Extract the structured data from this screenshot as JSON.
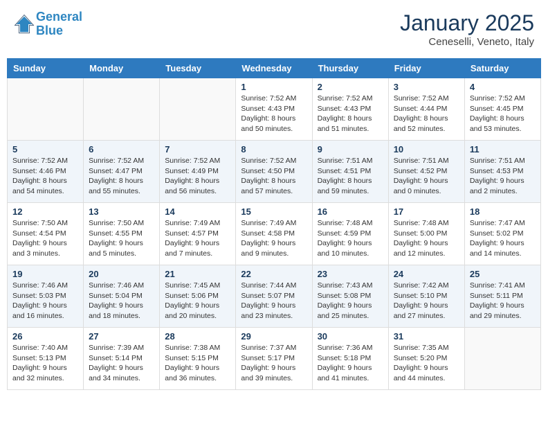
{
  "header": {
    "logo_line1": "General",
    "logo_line2": "Blue",
    "month": "January 2025",
    "location": "Ceneselli, Veneto, Italy"
  },
  "weekdays": [
    "Sunday",
    "Monday",
    "Tuesday",
    "Wednesday",
    "Thursday",
    "Friday",
    "Saturday"
  ],
  "weeks": [
    [
      {
        "day": "",
        "info": ""
      },
      {
        "day": "",
        "info": ""
      },
      {
        "day": "",
        "info": ""
      },
      {
        "day": "1",
        "info": "Sunrise: 7:52 AM\nSunset: 4:43 PM\nDaylight: 8 hours\nand 50 minutes."
      },
      {
        "day": "2",
        "info": "Sunrise: 7:52 AM\nSunset: 4:43 PM\nDaylight: 8 hours\nand 51 minutes."
      },
      {
        "day": "3",
        "info": "Sunrise: 7:52 AM\nSunset: 4:44 PM\nDaylight: 8 hours\nand 52 minutes."
      },
      {
        "day": "4",
        "info": "Sunrise: 7:52 AM\nSunset: 4:45 PM\nDaylight: 8 hours\nand 53 minutes."
      }
    ],
    [
      {
        "day": "5",
        "info": "Sunrise: 7:52 AM\nSunset: 4:46 PM\nDaylight: 8 hours\nand 54 minutes."
      },
      {
        "day": "6",
        "info": "Sunrise: 7:52 AM\nSunset: 4:47 PM\nDaylight: 8 hours\nand 55 minutes."
      },
      {
        "day": "7",
        "info": "Sunrise: 7:52 AM\nSunset: 4:49 PM\nDaylight: 8 hours\nand 56 minutes."
      },
      {
        "day": "8",
        "info": "Sunrise: 7:52 AM\nSunset: 4:50 PM\nDaylight: 8 hours\nand 57 minutes."
      },
      {
        "day": "9",
        "info": "Sunrise: 7:51 AM\nSunset: 4:51 PM\nDaylight: 8 hours\nand 59 minutes."
      },
      {
        "day": "10",
        "info": "Sunrise: 7:51 AM\nSunset: 4:52 PM\nDaylight: 9 hours\nand 0 minutes."
      },
      {
        "day": "11",
        "info": "Sunrise: 7:51 AM\nSunset: 4:53 PM\nDaylight: 9 hours\nand 2 minutes."
      }
    ],
    [
      {
        "day": "12",
        "info": "Sunrise: 7:50 AM\nSunset: 4:54 PM\nDaylight: 9 hours\nand 3 minutes."
      },
      {
        "day": "13",
        "info": "Sunrise: 7:50 AM\nSunset: 4:55 PM\nDaylight: 9 hours\nand 5 minutes."
      },
      {
        "day": "14",
        "info": "Sunrise: 7:49 AM\nSunset: 4:57 PM\nDaylight: 9 hours\nand 7 minutes."
      },
      {
        "day": "15",
        "info": "Sunrise: 7:49 AM\nSunset: 4:58 PM\nDaylight: 9 hours\nand 9 minutes."
      },
      {
        "day": "16",
        "info": "Sunrise: 7:48 AM\nSunset: 4:59 PM\nDaylight: 9 hours\nand 10 minutes."
      },
      {
        "day": "17",
        "info": "Sunrise: 7:48 AM\nSunset: 5:00 PM\nDaylight: 9 hours\nand 12 minutes."
      },
      {
        "day": "18",
        "info": "Sunrise: 7:47 AM\nSunset: 5:02 PM\nDaylight: 9 hours\nand 14 minutes."
      }
    ],
    [
      {
        "day": "19",
        "info": "Sunrise: 7:46 AM\nSunset: 5:03 PM\nDaylight: 9 hours\nand 16 minutes."
      },
      {
        "day": "20",
        "info": "Sunrise: 7:46 AM\nSunset: 5:04 PM\nDaylight: 9 hours\nand 18 minutes."
      },
      {
        "day": "21",
        "info": "Sunrise: 7:45 AM\nSunset: 5:06 PM\nDaylight: 9 hours\nand 20 minutes."
      },
      {
        "day": "22",
        "info": "Sunrise: 7:44 AM\nSunset: 5:07 PM\nDaylight: 9 hours\nand 23 minutes."
      },
      {
        "day": "23",
        "info": "Sunrise: 7:43 AM\nSunset: 5:08 PM\nDaylight: 9 hours\nand 25 minutes."
      },
      {
        "day": "24",
        "info": "Sunrise: 7:42 AM\nSunset: 5:10 PM\nDaylight: 9 hours\nand 27 minutes."
      },
      {
        "day": "25",
        "info": "Sunrise: 7:41 AM\nSunset: 5:11 PM\nDaylight: 9 hours\nand 29 minutes."
      }
    ],
    [
      {
        "day": "26",
        "info": "Sunrise: 7:40 AM\nSunset: 5:13 PM\nDaylight: 9 hours\nand 32 minutes."
      },
      {
        "day": "27",
        "info": "Sunrise: 7:39 AM\nSunset: 5:14 PM\nDaylight: 9 hours\nand 34 minutes."
      },
      {
        "day": "28",
        "info": "Sunrise: 7:38 AM\nSunset: 5:15 PM\nDaylight: 9 hours\nand 36 minutes."
      },
      {
        "day": "29",
        "info": "Sunrise: 7:37 AM\nSunset: 5:17 PM\nDaylight: 9 hours\nand 39 minutes."
      },
      {
        "day": "30",
        "info": "Sunrise: 7:36 AM\nSunset: 5:18 PM\nDaylight: 9 hours\nand 41 minutes."
      },
      {
        "day": "31",
        "info": "Sunrise: 7:35 AM\nSunset: 5:20 PM\nDaylight: 9 hours\nand 44 minutes."
      },
      {
        "day": "",
        "info": ""
      }
    ]
  ]
}
